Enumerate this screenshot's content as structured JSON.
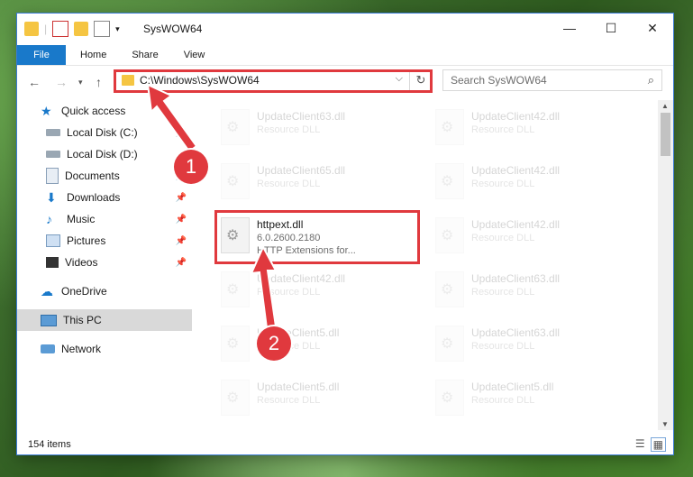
{
  "window": {
    "title": "SysWOW64",
    "controls": [
      "—",
      "☐",
      "✕"
    ]
  },
  "ribbon": {
    "file": "File",
    "tabs": [
      "Home",
      "Share",
      "View"
    ]
  },
  "address": {
    "path": "C:\\Windows\\SysWOW64",
    "search_placeholder": "Search SysWOW64"
  },
  "sidebar": {
    "items": [
      {
        "label": "Quick access"
      },
      {
        "label": "Local Disk (C:)"
      },
      {
        "label": "Local Disk (D:)"
      },
      {
        "label": "Documents"
      },
      {
        "label": "Downloads"
      },
      {
        "label": "Music"
      },
      {
        "label": "Pictures"
      },
      {
        "label": "Videos"
      },
      {
        "label": "OneDrive"
      },
      {
        "label": "This PC"
      },
      {
        "label": "Network"
      }
    ]
  },
  "files": {
    "left": [
      {
        "name": "UpdateClient63.dll",
        "sub": "Resource DLL"
      },
      {
        "name": "UpdateClient65.dll",
        "sub": "Resource DLL"
      },
      {
        "name": "httpext.dll",
        "sub": "6.0.2600.2180",
        "sub2": "HTTP Extensions for..."
      },
      {
        "name": "UpdateClient42.dll",
        "sub": "Resource DLL"
      },
      {
        "name": "UpdateClient5.dll",
        "sub": "Resource DLL"
      },
      {
        "name": "UpdateClient5.dll",
        "sub": "Resource DLL"
      }
    ],
    "right": [
      {
        "name": "UpdateClient42.dll",
        "sub": "Resource DLL"
      },
      {
        "name": "UpdateClient42.dll",
        "sub": "Resource DLL"
      },
      {
        "name": "UpdateClient42.dll",
        "sub": "Resource DLL"
      },
      {
        "name": "UpdateClient63.dll",
        "sub": "Resource DLL"
      },
      {
        "name": "UpdateClient63.dll",
        "sub": "Resource DLL"
      },
      {
        "name": "UpdateClient5.dll",
        "sub": "Resource DLL"
      }
    ]
  },
  "status": {
    "count": "154 items"
  },
  "badges": {
    "one": "1",
    "two": "2"
  },
  "colors": {
    "accent": "#1979ca",
    "highlight": "#e0393e"
  }
}
